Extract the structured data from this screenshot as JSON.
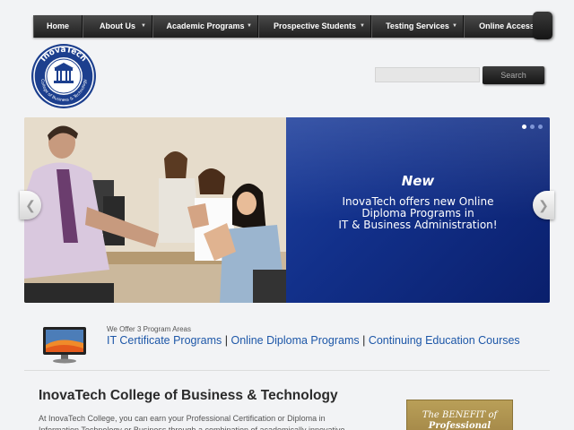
{
  "nav": {
    "items": [
      {
        "label": "Home",
        "has_dropdown": false
      },
      {
        "label": "About Us",
        "has_dropdown": true
      },
      {
        "label": "Academic Programs",
        "has_dropdown": true
      },
      {
        "label": "Prospective Students",
        "has_dropdown": true
      },
      {
        "label": "Testing Services",
        "has_dropdown": true
      },
      {
        "label": "Online Access",
        "has_dropdown": false
      }
    ]
  },
  "logo": {
    "name": "InovaTech",
    "subtitle": "College of Business & Technology"
  },
  "search": {
    "value": "",
    "button_label": "Search"
  },
  "slider": {
    "headline": "New",
    "body": "InovaTech offers new Online\nDiploma Programs in\nIT & Business Administration!",
    "slide_count": 3,
    "active_slide": 1,
    "panel_color": "#12308a"
  },
  "programs": {
    "caption": "We Offer 3 Program Areas",
    "links": [
      "IT Certificate Programs",
      "Online Diploma Programs",
      "Continuing Education Courses"
    ],
    "separator": "|",
    "link_color": "#1d57a8"
  },
  "main": {
    "title": "InovaTech College of Business & Technology",
    "intro": "At InovaTech College, you can earn your Professional Certification or Diploma in Information Technology or Business through a combination of academically innovative"
  },
  "benefit_banner": {
    "line1": "The BENEFIT of",
    "line2": "Professional Education"
  }
}
